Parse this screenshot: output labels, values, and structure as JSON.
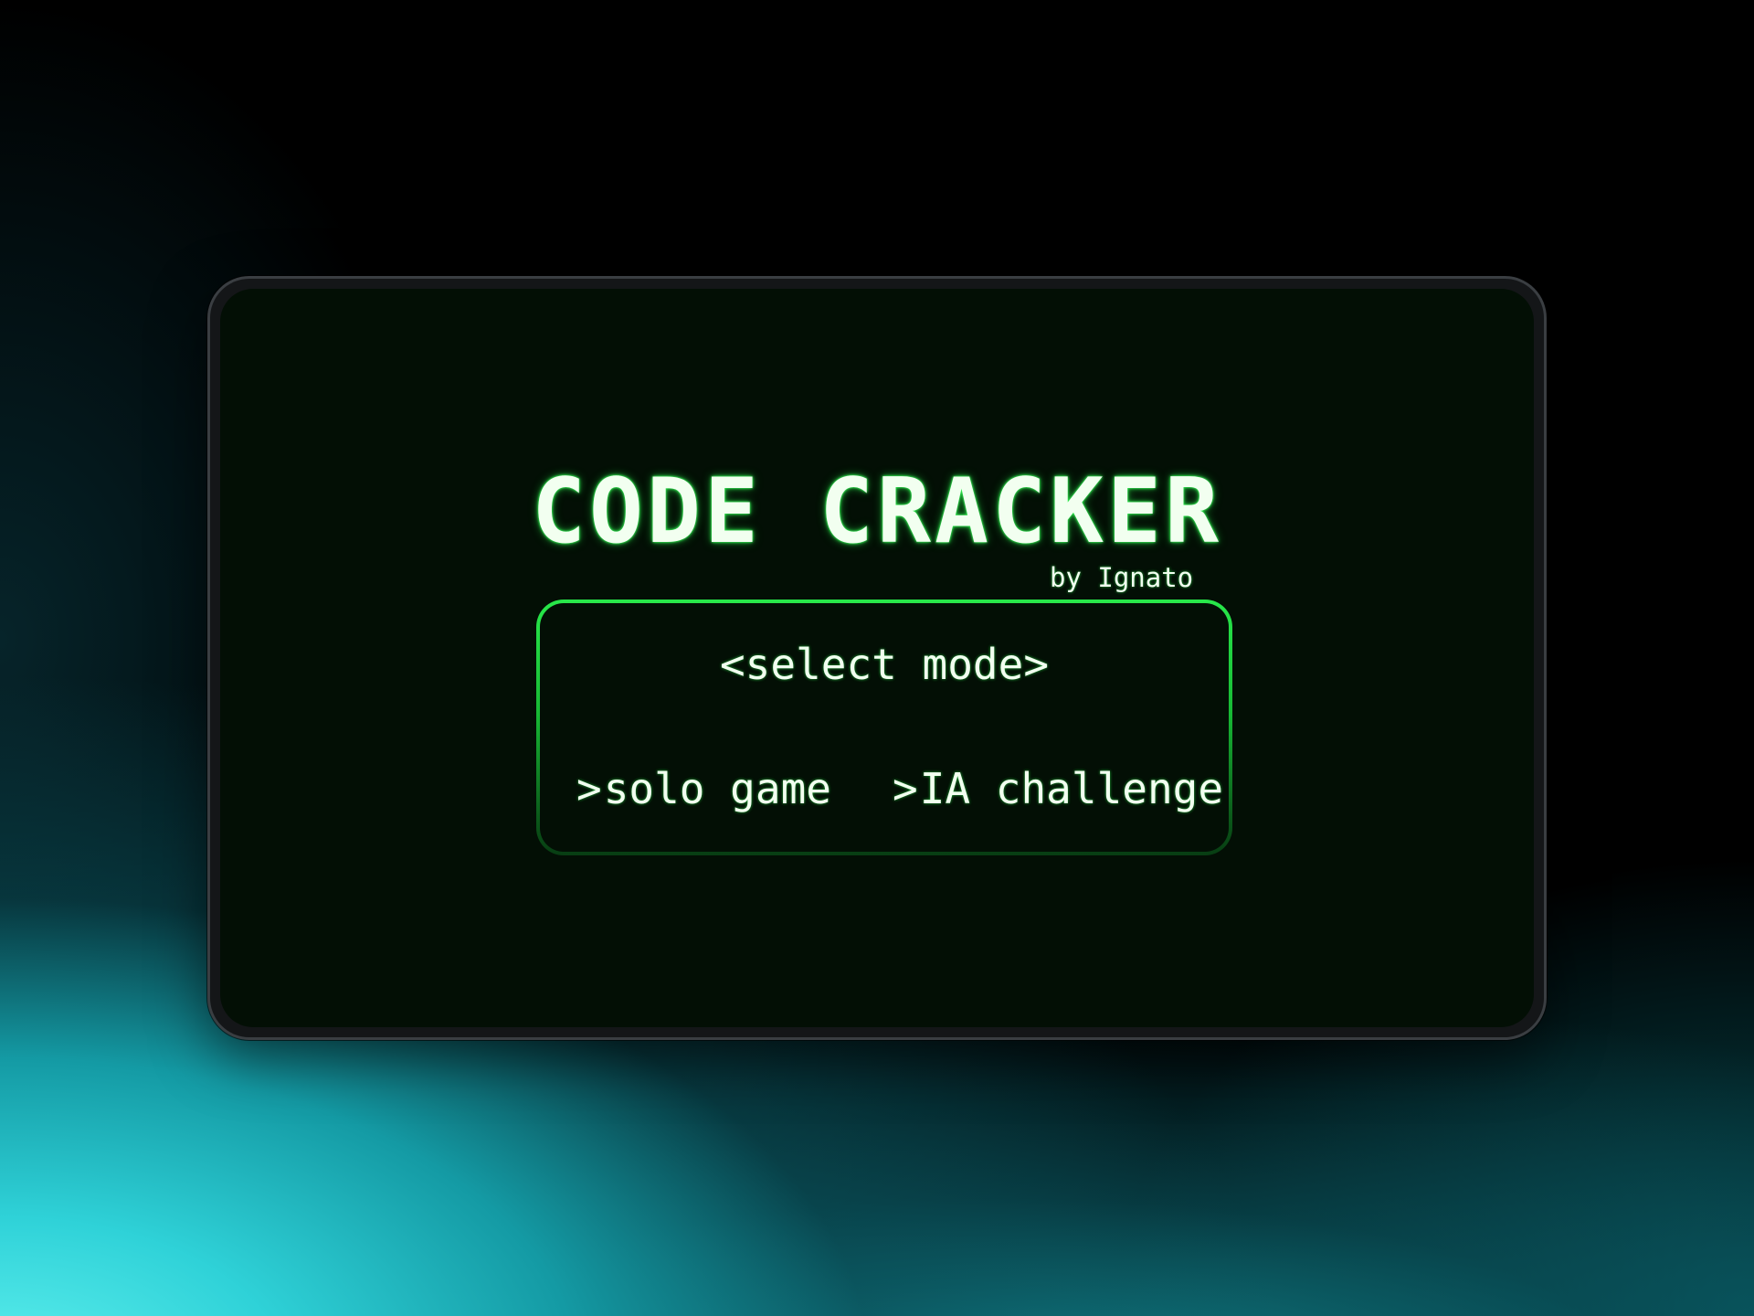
{
  "game": {
    "title": "CODE CRACKER",
    "byline": "by Ignato",
    "menu": {
      "heading": "<select mode>",
      "prompt_symbol": ">",
      "options": [
        {
          "label": "solo game"
        },
        {
          "label": "IA challenge"
        }
      ]
    }
  },
  "colors": {
    "screen_background": "#030f05",
    "text": "#f2fff0",
    "glow": "#28e84a",
    "menu_border": "#28e84a"
  }
}
